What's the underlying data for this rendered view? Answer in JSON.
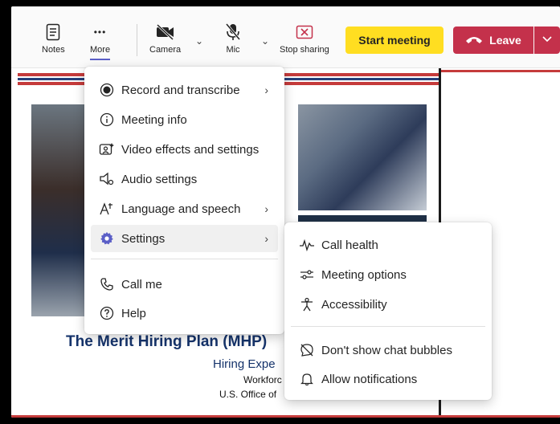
{
  "toolbar": {
    "notes_label": "Notes",
    "more_label": "More",
    "camera_label": "Camera",
    "mic_label": "Mic",
    "stop_sharing_label": "Stop sharing",
    "start_meeting_label": "Start meeting",
    "leave_label": "Leave",
    "more_dots": "•••"
  },
  "more_menu": {
    "items": [
      {
        "label": "Record and transcribe",
        "icon": "record-icon",
        "has_submenu": true
      },
      {
        "label": "Meeting info",
        "icon": "info-icon",
        "has_submenu": false
      },
      {
        "label": "Video effects and settings",
        "icon": "video-effects-icon",
        "has_submenu": false
      },
      {
        "label": "Audio settings",
        "icon": "audio-settings-icon",
        "has_submenu": false
      },
      {
        "label": "Language and speech",
        "icon": "language-icon",
        "has_submenu": true
      },
      {
        "label": "Settings",
        "icon": "gear-icon",
        "has_submenu": true
      },
      {
        "label": "Call me",
        "icon": "phone-icon",
        "has_submenu": false
      },
      {
        "label": "Help",
        "icon": "help-icon",
        "has_submenu": false
      }
    ]
  },
  "settings_submenu": {
    "items": [
      {
        "label": "Call health",
        "icon": "pulse-icon"
      },
      {
        "label": "Meeting options",
        "icon": "sliders-icon"
      },
      {
        "label": "Accessibility",
        "icon": "accessibility-icon"
      },
      {
        "label": "Don't show chat bubbles",
        "icon": "chat-off-icon"
      },
      {
        "label": "Allow notifications",
        "icon": "bell-icon"
      }
    ]
  },
  "slide": {
    "title": "The Merit Hiring Plan (MHP)",
    "subtitle": "Hiring Expe",
    "line2": "Workforc",
    "line3": "U.S. Office of"
  },
  "colors": {
    "accent": "#5b5fc7",
    "start_meeting": "#ffde21",
    "leave": "#c4314b",
    "slide_title": "#15336b"
  }
}
